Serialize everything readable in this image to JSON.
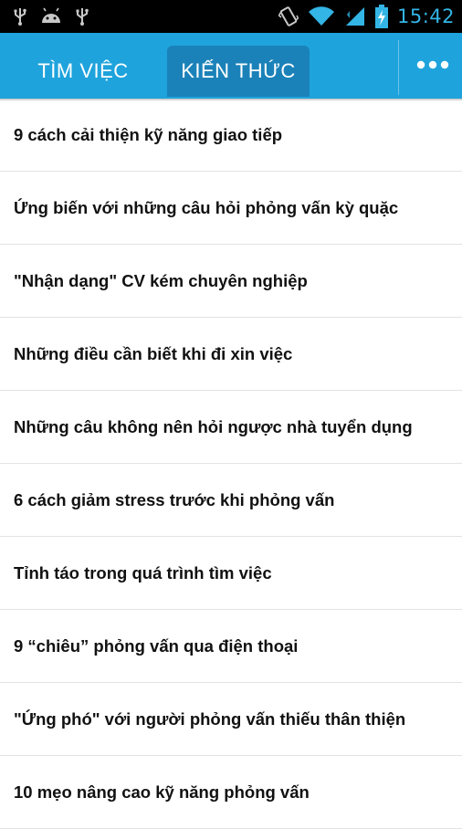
{
  "status_bar": {
    "time": "15:42",
    "left_icons": [
      "usb-icon",
      "android-debug-icon",
      "usb-icon"
    ],
    "right_icons": [
      "vibrate-icon",
      "wifi-icon",
      "signal-icon",
      "battery-charging-icon"
    ]
  },
  "tabs": [
    {
      "label": "TÌM VIỆC",
      "selected": false
    },
    {
      "label": "KIẾN THỨC",
      "selected": true
    }
  ],
  "articles": [
    "9 cách cải thiện kỹ năng giao tiếp",
    "Ứng biến với những câu hỏi phỏng vấn kỳ quặc",
    "\"Nhận dạng\" CV kém chuyên nghiệp",
    "Những điều cần biết khi đi xin việc",
    "Những câu không nên hỏi ngược nhà tuyển dụng",
    "6 cách giảm stress trước khi phỏng vấn",
    "Tỉnh táo trong quá trình tìm việc",
    "9 “chiêu” phỏng vấn qua điện thoại",
    "\"Ứng phó\" với người phỏng vấn thiếu thân thiện",
    "10 mẹo nâng cao kỹ năng phỏng vấn"
  ],
  "colors": {
    "action_bar": "#1ea3dc",
    "selected_tab": "#1b82b9",
    "clock": "#33b5e5"
  }
}
